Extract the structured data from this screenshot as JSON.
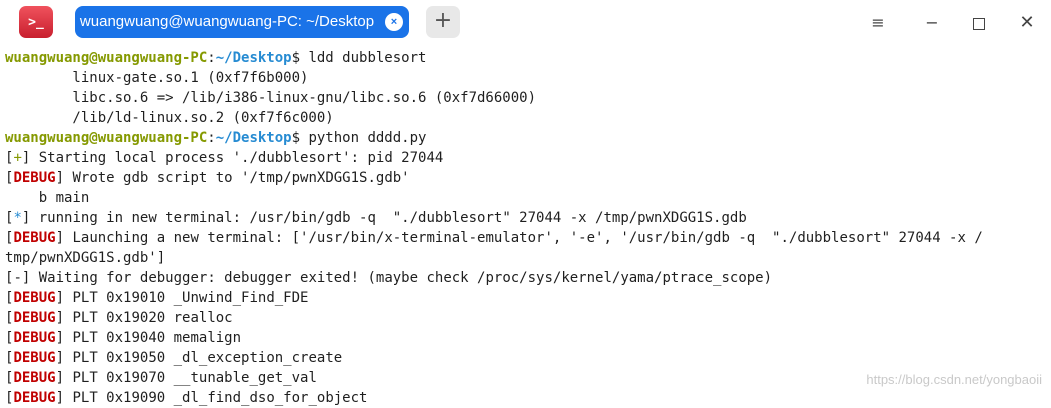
{
  "titlebar": {
    "app_icon_glyph": ">_",
    "tab_title": "wuangwuang@wuangwuang-PC: ~/Desktop",
    "tab_close_glyph": "×",
    "new_tab_glyph": "+",
    "menu_glyph": "≡",
    "minimize_glyph": "−",
    "close_glyph": "✕"
  },
  "terminal": {
    "prompt_user": "wuangwuang@wuangwuang-PC",
    "prompt_colon": ":",
    "prompt_path": "~/Desktop",
    "prompt_dollar": "$ ",
    "cmd1": "ldd dubblesort",
    "ldd_line1": "        linux-gate.so.1 (0xf7f6b000)",
    "ldd_line2": "        libc.so.6 => /lib/i386-linux-gnu/libc.so.6 (0xf7d66000)",
    "ldd_line3": "        /lib/ld-linux.so.2 (0xf7f6c000)",
    "cmd2": "python dddd.py",
    "tag_plus": "+",
    "tag_star": "*",
    "tag_minus": "-",
    "debug_tag": "DEBUG",
    "starting": " Starting local process './dubblesort': pid 27044",
    "wrote_gdb": " Wrote gdb script to '/tmp/pwnXDGG1S.gdb'",
    "b_main": "    b main",
    "running": " running in new terminal: /usr/bin/gdb -q  \"./dubblesort\" 27044 -x /tmp/pwnXDGG1S.gdb",
    "launching": " Launching a new terminal: ['/usr/bin/x-terminal-emulator', '-e', '/usr/bin/gdb -q  \"./dubblesort\" 27044 -x /",
    "launching_wrap": "tmp/pwnXDGG1S.gdb']",
    "waiting": " Waiting for debugger: debugger exited! (maybe check /proc/sys/kernel/yama/ptrace_scope)",
    "plt1": " PLT 0x19010 _Unwind_Find_FDE",
    "plt2": " PLT 0x19020 realloc",
    "plt3": " PLT 0x19040 memalign",
    "plt4": " PLT 0x19050 _dl_exception_create",
    "plt5": " PLT 0x19070 __tunable_get_val",
    "plt6": " PLT 0x19090 _dl_find_dso_for_object"
  },
  "watermark": "https://blog.csdn.net/yongbaoii",
  "colors": {
    "prompt_user": "#859900",
    "prompt_path": "#268bd2",
    "debug_tag": "#c00000",
    "tab_active": "#1a73e8"
  }
}
